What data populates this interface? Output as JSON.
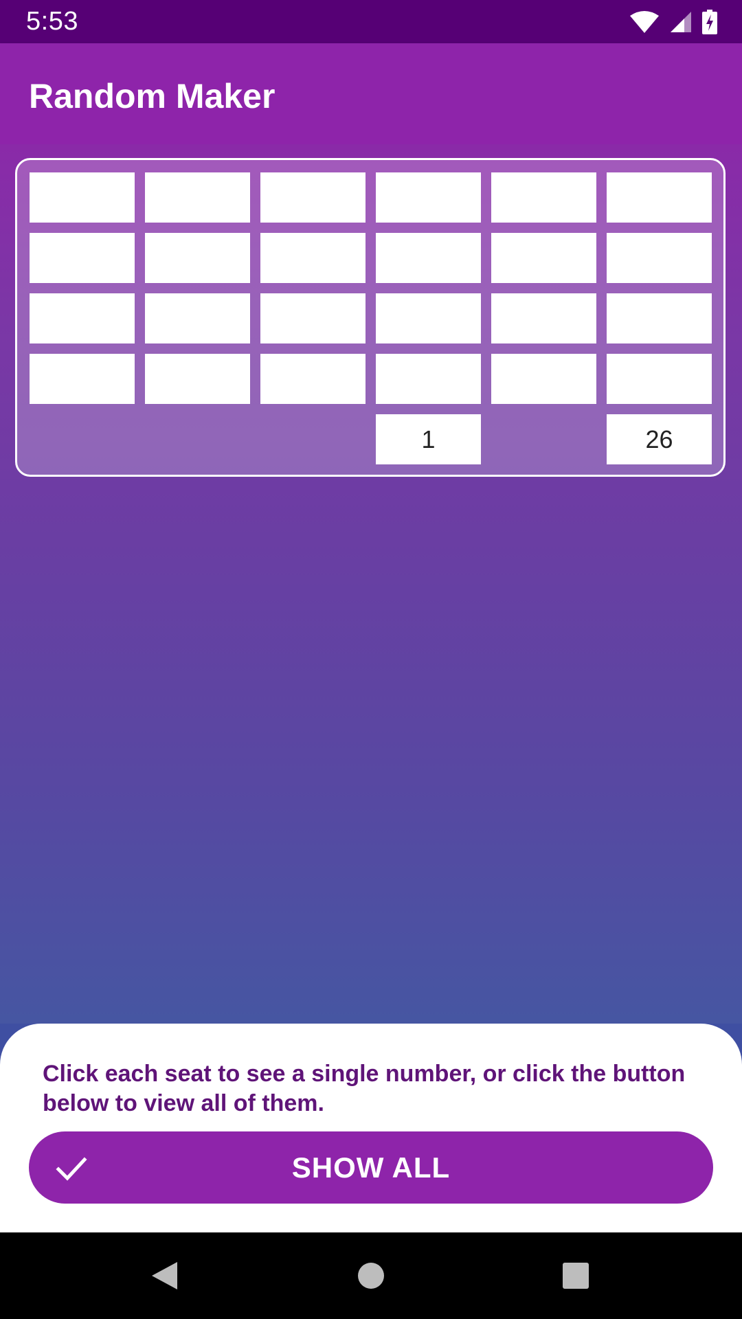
{
  "status_bar": {
    "time": "5:53",
    "icons": [
      "wifi-icon",
      "cellular-signal-icon",
      "battery-charging-icon"
    ]
  },
  "app_bar": {
    "title": "Random Maker",
    "color": "#8e24aa"
  },
  "seat_grid": {
    "rows": [
      [
        "",
        "",
        "",
        "",
        "",
        ""
      ],
      [
        "",
        "",
        "",
        "",
        "",
        ""
      ],
      [
        "",
        "",
        "",
        "",
        "",
        ""
      ],
      [
        "",
        "",
        "",
        "",
        "",
        ""
      ],
      [
        null,
        null,
        null,
        "1",
        null,
        "26"
      ]
    ]
  },
  "bottom_sheet": {
    "instruction": "Click each seat to see a single number, or click the button below to view all of them.",
    "show_all_label": "SHOW ALL",
    "show_all_icon": "check-icon"
  },
  "nav_bar": {
    "icons": [
      "back-icon",
      "home-icon",
      "recents-icon"
    ]
  }
}
